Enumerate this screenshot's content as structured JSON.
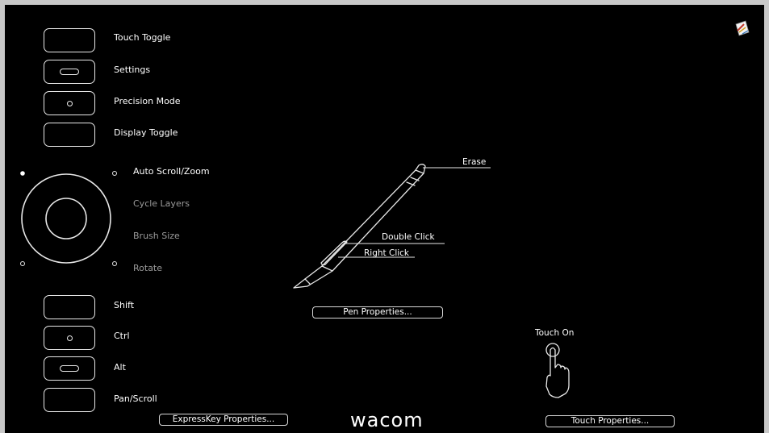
{
  "expresskeys_top": [
    {
      "label": "Touch Toggle",
      "marker": "none"
    },
    {
      "label": "Settings",
      "marker": "pill"
    },
    {
      "label": "Precision Mode",
      "marker": "dot"
    },
    {
      "label": "Display Toggle",
      "marker": "none"
    }
  ],
  "touch_ring": [
    {
      "label": "Auto Scroll/Zoom",
      "state": "active"
    },
    {
      "label": "Cycle Layers",
      "state": "dim"
    },
    {
      "label": "Brush Size",
      "state": "dim"
    },
    {
      "label": "Rotate",
      "state": "dim"
    }
  ],
  "expresskeys_bottom": [
    {
      "label": "Shift",
      "marker": "none"
    },
    {
      "label": "Ctrl",
      "marker": "dot"
    },
    {
      "label": "Alt",
      "marker": "pill"
    },
    {
      "label": "Pan/Scroll",
      "marker": "none"
    }
  ],
  "pen": {
    "erase": "Erase",
    "upper_side_switch": "Double Click",
    "lower_side_switch": "Right Click",
    "properties_button": "Pen Properties..."
  },
  "touch": {
    "status": "Touch On",
    "properties_button": "Touch Properties..."
  },
  "expresskey_properties_button": "ExpressKey Properties...",
  "logo": "wacom",
  "icons": {
    "corner_app": "pen-tablet-app-icon",
    "touch": "pointing-hand-icon"
  },
  "colors": {
    "background": "#000000",
    "foreground": "#ffffff",
    "dim_text": "#9a9a9a",
    "frame": "#c8c8c8"
  }
}
